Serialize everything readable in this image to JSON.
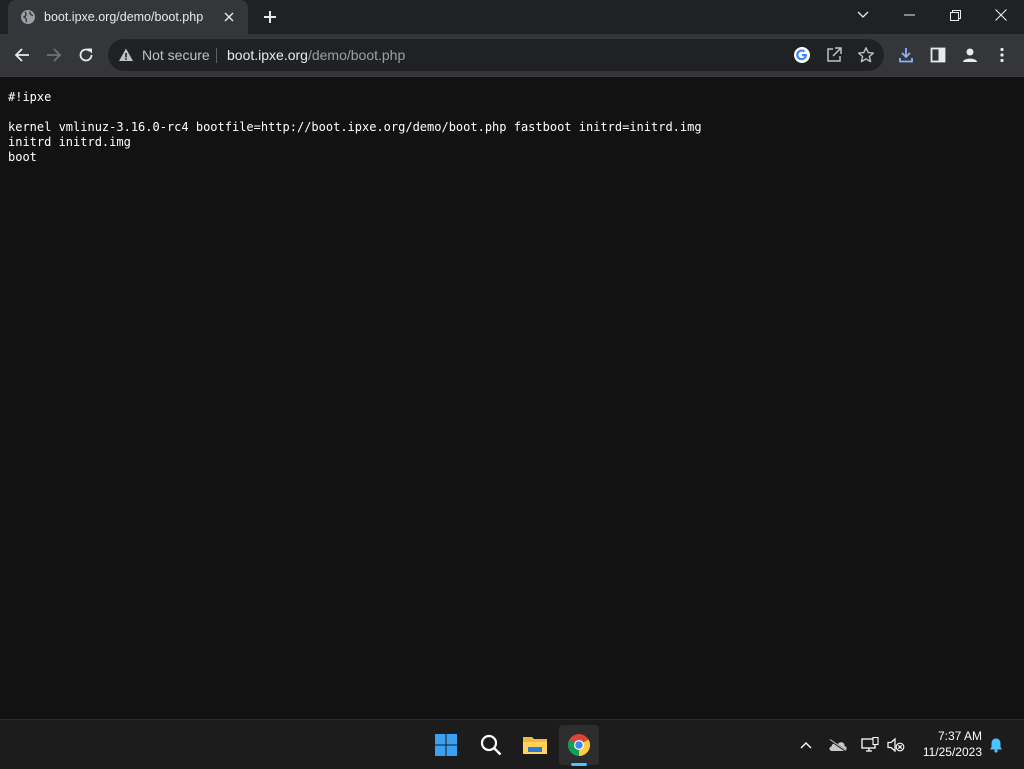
{
  "browser": {
    "tab": {
      "title": "boot.ipxe.org/demo/boot.php",
      "favicon": "globe-icon"
    },
    "address_bar": {
      "security_label": "Not secure",
      "url_host": "boot.ipxe.org",
      "url_path": "/demo/boot.php"
    },
    "toolbar_icons": [
      "back-icon",
      "forward-icon",
      "reload-icon",
      "google-lens-icon",
      "share-icon",
      "bookmark-star-icon",
      "download-icon",
      "side-panel-icon",
      "profile-icon",
      "menu-icon"
    ]
  },
  "page": {
    "script_text": "#!ipxe\n\nkernel vmlinuz-3.16.0-rc4 bootfile=http://boot.ipxe.org/demo/boot.php fastboot initrd=initrd.img\ninitrd initrd.img\nboot"
  },
  "taskbar": {
    "apps": [
      "windows-start-icon",
      "search-icon",
      "file-explorer-icon",
      "chrome-icon"
    ],
    "tray": [
      "chevron-up-icon",
      "onedrive-icon",
      "network-icon",
      "volume-muted-icon",
      "notification-bell-icon"
    ],
    "clock": {
      "time": "7:37 AM",
      "date": "11/25/2023"
    }
  },
  "colors": {
    "page_bg": "#121212",
    "toolbar_bg": "#35363a",
    "tabstrip_bg": "#202124",
    "taskbar_bg": "#1c1c1c",
    "accent": "#4cc2ff"
  }
}
